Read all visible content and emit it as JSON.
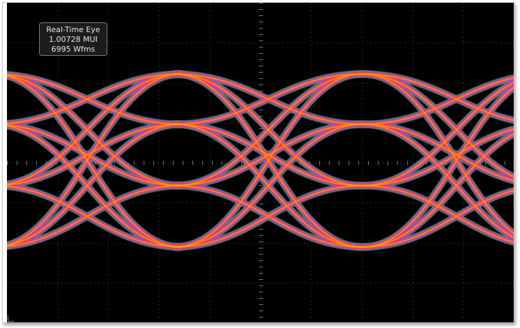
{
  "display": {
    "background_color": "#000000",
    "grid_color": "#4a4a4a",
    "readout": {
      "title": "Real-Time Eye",
      "unit_intervals": "1.00728 MUI",
      "waveforms": "6995 Wfms"
    }
  },
  "eye_diagram": {
    "signal": "PAM4",
    "levels": 4,
    "eyes_visible": 2,
    "colors": {
      "hot": "#fff2a0",
      "warm": "#ff9a1a",
      "mid": "#e8331a",
      "cool": "#e23cff",
      "cold": "#3d5bff",
      "edge": "#35e82a"
    }
  }
}
